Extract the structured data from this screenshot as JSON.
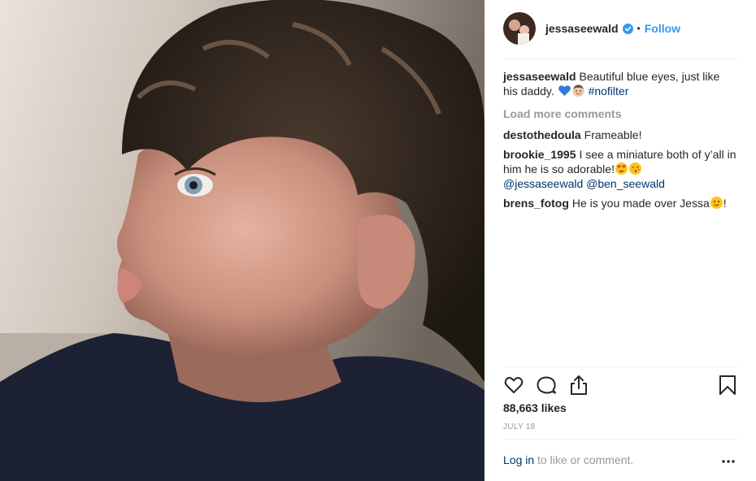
{
  "post": {
    "author": "jessaseewald",
    "verified": true,
    "follow_label": "Follow",
    "separator": "•"
  },
  "caption": {
    "user": "jessaseewald",
    "text": "Beautiful blue eyes, just like his daddy.",
    "emoji": [
      "blue-heart",
      "boy-face"
    ],
    "hashtag": "#nofilter"
  },
  "load_more_label": "Load more comments",
  "comments": [
    {
      "user": "destothedoula",
      "text": "Frameable!"
    },
    {
      "user": "brookie_1995",
      "text": "I see a miniature both of y’all in him he is so adorable!",
      "emoji": [
        "heart-eyes",
        "kissing-face"
      ],
      "mentions": "@jessaseewald @ben_seewald"
    },
    {
      "user": "brens_fotog",
      "text": "He is you made over Jessa",
      "emoji": [
        "slight-smile"
      ],
      "suffix": "!"
    }
  ],
  "likes": "88,663 likes",
  "date": "JULY 18",
  "footer": {
    "login_label": "Log in",
    "rest": " to like or comment."
  },
  "icons": [
    "heart-icon",
    "comment-icon",
    "share-icon",
    "bookmark-icon",
    "more-options-icon"
  ],
  "colors": {
    "link": "#3897f0",
    "tag": "#003569",
    "muted": "#999999",
    "text": "#262626"
  }
}
